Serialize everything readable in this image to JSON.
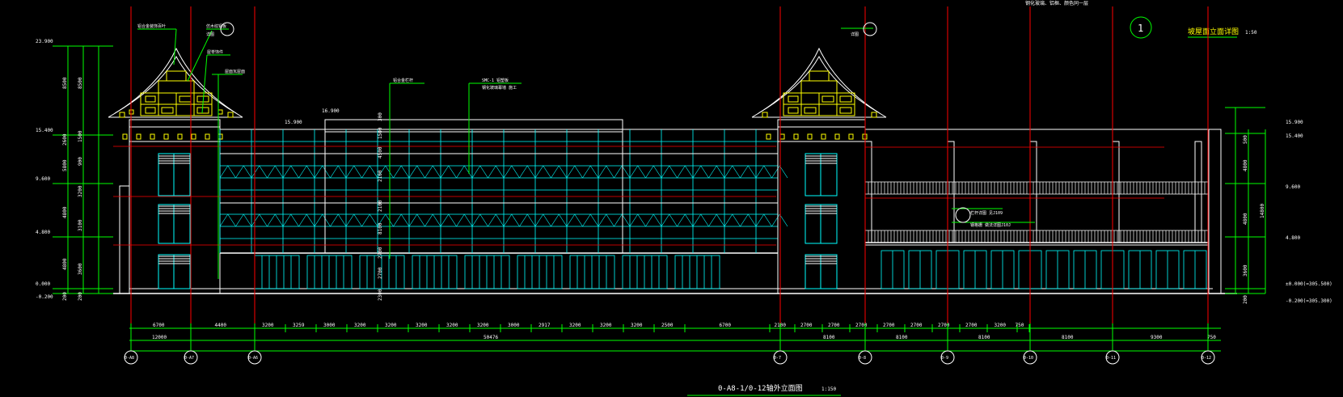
{
  "drawing": {
    "title": "0-A8-1/0-12轴外立面图",
    "title_scale": "1:150",
    "detail_title": "坡屋面立面详图",
    "detail_scale": "1:50",
    "detail_number": "1",
    "top_right_note": "钢化玻璃、铝框、颜色同一层"
  },
  "left_elevations": [
    "23.900",
    "15.400",
    "9.600",
    "4.800",
    "0.000",
    "-0.200"
  ],
  "left_dims_outer": [
    "8500",
    "2600",
    "5800",
    "4800",
    "4800",
    "200"
  ],
  "left_dims_inner": [
    "8500",
    "1500",
    "900",
    "3200",
    "3100",
    "3600",
    "200"
  ],
  "right_elevations": [
    "15.900",
    "15.400",
    "9.600",
    "4.800",
    "±0.000(=305.500)",
    "-0.200(=305.300)"
  ],
  "right_dims": [
    "500",
    "4800",
    "4800",
    "3600",
    "200"
  ],
  "right_total": "14800",
  "inline_elevations": [
    "15.900",
    "16.900"
  ],
  "center_dims": [
    "300",
    "1500",
    "4500",
    "2100",
    "2100",
    "8100",
    "2700",
    "2700",
    "2300"
  ],
  "callouts": {
    "left_roof_1": "铝合金装饰百叶",
    "left_roof_2": "仿木纹铝板",
    "left_roof_3": "屋脊饰件",
    "left_roof_4": "屋面瓦屋面",
    "left_ref": "详图",
    "center_1": "铝合金栏杆",
    "center_2": "SMC-1 铝塑板",
    "center_3": "钢化玻璃幕墙 施工",
    "right_ref": "详图",
    "right_note_1": "栏杆详图 见J109",
    "right_note_2": "钢格栅 做法详图J10J"
  },
  "bottom_dims_row1": [
    "6700",
    "4400",
    "3200",
    "3259",
    "3000",
    "3200",
    "3200",
    "3200",
    "3200",
    "3200",
    "3000",
    "2917",
    "3200",
    "3200",
    "3200",
    "2500",
    "6700",
    "2100",
    "2700",
    "2700",
    "2700",
    "2700",
    "2700",
    "2700",
    "2700",
    "3200",
    "750"
  ],
  "bottom_dims_row2": [
    "12000",
    "50476",
    "8100",
    "8100",
    "8100",
    "8100",
    "9300",
    "750"
  ],
  "axes": [
    "0-A8",
    "0-A7",
    "0-A6",
    "0-7",
    "0-8",
    "0-9",
    "0-10",
    "0-11",
    "0-12"
  ],
  "colors": {
    "background": "#000000",
    "white": "#ffffff",
    "cyan": "#00ffff",
    "green": "#00ff00",
    "red": "#ff0000",
    "yellow": "#ffff00",
    "magenta": "#ff00ff"
  }
}
